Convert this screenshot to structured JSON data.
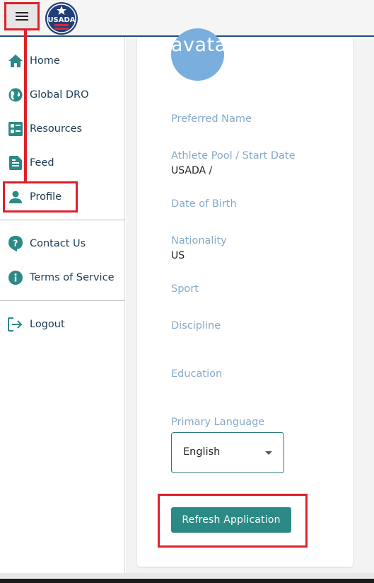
{
  "header": {
    "menu_icon": "hamburger-menu-icon",
    "logo_text": "USADA"
  },
  "sidebar": {
    "items": [
      {
        "label": "Home",
        "icon": "home-icon"
      },
      {
        "label": "Global DRO",
        "icon": "globe-icon"
      },
      {
        "label": "Resources",
        "icon": "resources-icon"
      },
      {
        "label": "Feed",
        "icon": "feed-document-icon"
      },
      {
        "label": "Profile",
        "icon": "person-icon"
      },
      {
        "label": "Contact Us",
        "icon": "help-question-icon"
      },
      {
        "label": "Terms of Service",
        "icon": "info-icon"
      },
      {
        "label": "Logout",
        "icon": "logout-icon"
      }
    ]
  },
  "profile": {
    "avatar_text": "avata",
    "fields": [
      {
        "label": "Preferred Name",
        "value": ""
      },
      {
        "label": "Athlete Pool / Start Date",
        "value": "USADA /"
      },
      {
        "label": "Date of Birth",
        "value": ""
      },
      {
        "label": "Nationality",
        "value": "US"
      },
      {
        "label": "Sport",
        "value": ""
      },
      {
        "label": "Discipline",
        "value": ""
      },
      {
        "label": "Education",
        "value": ""
      },
      {
        "label": "Primary Language",
        "value": ""
      }
    ],
    "language_select": {
      "value": "English"
    },
    "refresh_label": "Refresh Application"
  },
  "colors": {
    "accent": "#2b8a86",
    "nav_text": "#1b3a52",
    "label": "#86a9c9",
    "annotation": "#e0202a",
    "header_border": "#1f4e79"
  }
}
